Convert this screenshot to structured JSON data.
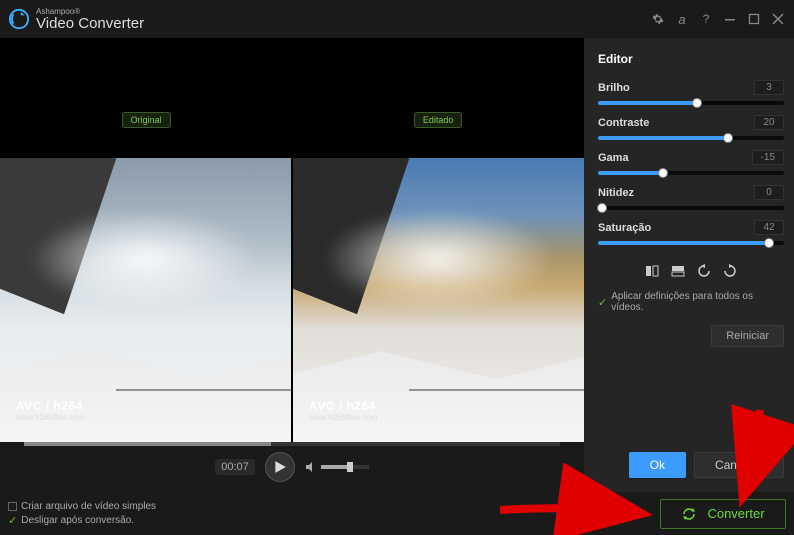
{
  "app": {
    "brand_small": "Ashampoo®",
    "brand_large": "Video Converter"
  },
  "preview": {
    "original_tag": "Original",
    "edited_tag": "Editado",
    "watermark_codec": "AVC / h264",
    "watermark_site": "www.h265files.com",
    "current_time": "00:07"
  },
  "editor": {
    "title": "Editor",
    "sliders": [
      {
        "label": "Brilho",
        "value": "3",
        "pct": 53
      },
      {
        "label": "Contraste",
        "value": "20",
        "pct": 70
      },
      {
        "label": "Gama",
        "value": "-15",
        "pct": 35
      },
      {
        "label": "Nitidez",
        "value": "0",
        "pct": 2
      },
      {
        "label": "Saturação",
        "value": "42",
        "pct": 92
      }
    ],
    "apply_all": "Aplicar definições para todos os vídeos.",
    "reset": "Reiniciar",
    "ok": "Ok",
    "cancel": "Cancelar"
  },
  "footer": {
    "simple_file": "Criar arquivo de vídeo simples",
    "shutdown": "Desligar após conversão.",
    "convert": "Converter"
  }
}
